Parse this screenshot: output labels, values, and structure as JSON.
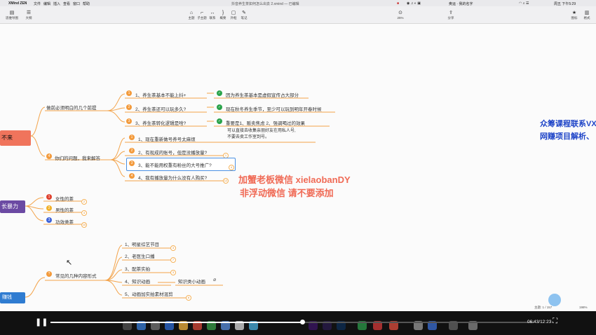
{
  "menubar": {
    "app": "XMind ZEN",
    "menus": [
      "文件",
      "编辑",
      "插入",
      "查看",
      "窗口",
      "帮助"
    ],
    "title": "抖音养生茶如何怎么出去 2.xmind — 已编辑",
    "right_text": "奥运 · 我的名字",
    "clock": "周五 下午5:29"
  },
  "toolbar": {
    "left": [
      {
        "icon": "▤",
        "label": "思维导图"
      },
      {
        "icon": "☰",
        "label": "大纲"
      }
    ],
    "center": [
      {
        "icon": "⌂",
        "label": "主题"
      },
      {
        "icon": "⌐",
        "label": "子主题"
      },
      {
        "icon": "↔",
        "label": "联系"
      },
      {
        "icon": "}",
        "label": "概要"
      },
      {
        "icon": "▢",
        "label": "外框"
      },
      {
        "icon": "✎",
        "label": "笔记"
      }
    ],
    "zoom": "25%",
    "share": "分享",
    "right": [
      {
        "icon": "★",
        "label": "图标"
      },
      {
        "icon": "▥",
        "label": "格式"
      }
    ]
  },
  "mindmap": {
    "main1": "不来",
    "main2": "长暴力",
    "main3": "赚钱",
    "branch1": "做前必须明白的几个前提",
    "b1_items": [
      {
        "num": "1",
        "text": "1、养生茶基本不能上抖+",
        "note": "因为养生茶基本是虚假宣传占大部分"
      },
      {
        "num": "2",
        "text": "2、养生茶还可以玩多久?",
        "note": "现在秋冬养生季节，至少可以玩到明年开春时候"
      },
      {
        "num": "3",
        "text": "3、养生茶转化逻辑是啥?",
        "note": "重要是1、贩卖焦虑  2、强调喝过的效果"
      }
    ],
    "branch2": "你们的问题，我来解答",
    "b2_items": [
      {
        "num": "1",
        "text": "1、现在重新做号养号太麻烦",
        "ring": ""
      },
      {
        "num": "2",
        "text": "2、有现成的账号，但是没播放量?",
        "ring": "1"
      },
      {
        "num": "3",
        "text": "3、能不能用权重有粉丝的大号推广?",
        "ring": "4"
      },
      {
        "num": "4",
        "text": "4、我有播放量为什么没有人购买?",
        "ring": "12"
      }
    ],
    "b2_note_line1": "可以直接去收集亲朋好友在用私人号,",
    "b2_note_line2": "不要去卖工作室到号。",
    "b3_items": [
      {
        "num": "1",
        "text": "女性的茶",
        "ring": "2"
      },
      {
        "num": "2",
        "text": "男性的茶",
        "ring": "4"
      },
      {
        "num": "3",
        "text": "功效类茶",
        "ring": "10"
      }
    ],
    "branch4": "常见的几种内容形式",
    "b4_items": [
      {
        "text": "1、明星综艺节目",
        "ring": "3"
      },
      {
        "text": "2、老医生口播",
        "ring": "7"
      },
      {
        "text": "3、配茶实拍",
        "ring": "3"
      },
      {
        "text": "4、知识动画",
        "ring": ""
      },
      {
        "text": "5、动画加实拍素材混剪",
        "ring": "6"
      }
    ],
    "b4_child": "知识类小动画"
  },
  "overlay": {
    "red1": "加蟹老板微信 xielaobanDY",
    "red2": "非浮动微信 请不要添加",
    "wm1": "众筹课程联系VX",
    "wm2": "网赚项目解析、"
  },
  "status": {
    "topics": "主题: 1 / 157",
    "zoom": "198%"
  },
  "video": {
    "time": "06:43/12:23",
    "progress": 0.52
  },
  "colors": {
    "orange": "#f39a3b",
    "red_text": "#f06a55",
    "purple": "#6b4aa3",
    "blue": "#2f7cd1"
  }
}
